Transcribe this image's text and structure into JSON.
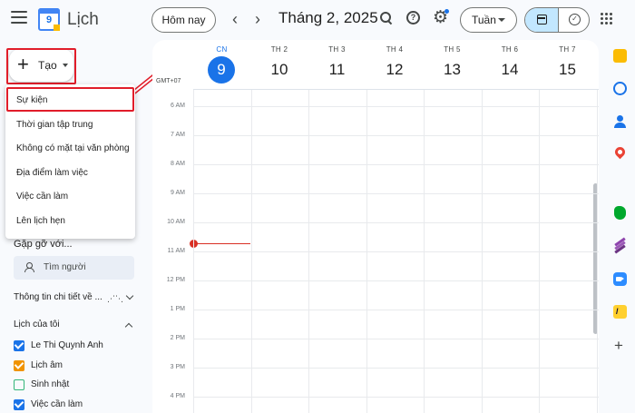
{
  "header": {
    "app_title": "Lịch",
    "logo_number": "9",
    "today_label": "Hôm nay",
    "month_title": "Tháng 2, 2025",
    "view_label": "Tuần",
    "help_glyph": "?"
  },
  "create": {
    "label": "Tạo",
    "menu_items": [
      "Sự kiện",
      "Thời gian tập trung",
      "Không có mặt tại văn phòng",
      "Địa điểm làm việc",
      "Việc cần làm",
      "Lên lịch hẹn"
    ]
  },
  "sidebar": {
    "meet_title": "Gặp gỡ với...",
    "search_people_placeholder": "Tìm người",
    "details_label": "Thông tin chi tiết về ...",
    "my_calendars_label": "Lịch của tôi",
    "calendars": [
      {
        "name": "Le Thi Quynh Anh",
        "color": "#1a73e8",
        "checked": true
      },
      {
        "name": "Lịch âm",
        "color": "#f09300",
        "checked": true
      },
      {
        "name": "Sinh nhật",
        "color": "#33b679",
        "checked": false
      },
      {
        "name": "Việc cần làm",
        "color": "#1a73e8",
        "checked": true
      }
    ]
  },
  "calendar": {
    "timezone": "GMT+07",
    "days": [
      {
        "name": "CN",
        "num": "9",
        "today": true
      },
      {
        "name": "TH 2",
        "num": "10",
        "today": false
      },
      {
        "name": "TH 3",
        "num": "11",
        "today": false
      },
      {
        "name": "TH 4",
        "num": "12",
        "today": false
      },
      {
        "name": "TH 5",
        "num": "13",
        "today": false
      },
      {
        "name": "TH 6",
        "num": "14",
        "today": false
      },
      {
        "name": "TH 7",
        "num": "15",
        "today": false
      }
    ],
    "hours": [
      "6 AM",
      "7 AM",
      "8 AM",
      "9 AM",
      "10 AM",
      "11 AM",
      "12 PM",
      "1 PM",
      "2 PM",
      "3 PM",
      "4 PM"
    ]
  },
  "colors": {
    "accent": "#1a73e8",
    "annotation_red": "#e11d2a",
    "now_line": "#d93025"
  }
}
